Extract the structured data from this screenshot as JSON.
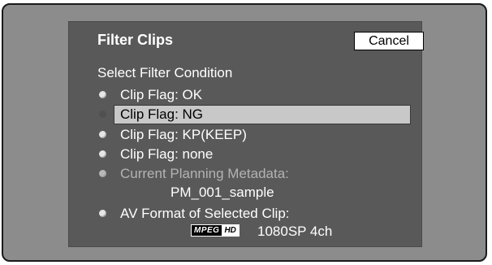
{
  "dialog": {
    "title": "Filter Clips",
    "cancel_label": "Cancel",
    "subtitle": "Select Filter Condition"
  },
  "options": [
    {
      "label": "Clip Flag: OK",
      "state": "normal"
    },
    {
      "label": "Clip Flag: NG",
      "state": "selected"
    },
    {
      "label": "Clip Flag: KP(KEEP)",
      "state": "normal"
    },
    {
      "label": "Clip Flag: none",
      "state": "normal"
    },
    {
      "label": "Current Planning Metadata:",
      "state": "disabled",
      "value": "PM_001_sample"
    },
    {
      "label": "AV Format of Selected Clip:",
      "state": "normal",
      "value": "1080SP 4ch"
    }
  ],
  "format_logo": {
    "mpeg": "MPEG",
    "hd": "HD"
  }
}
